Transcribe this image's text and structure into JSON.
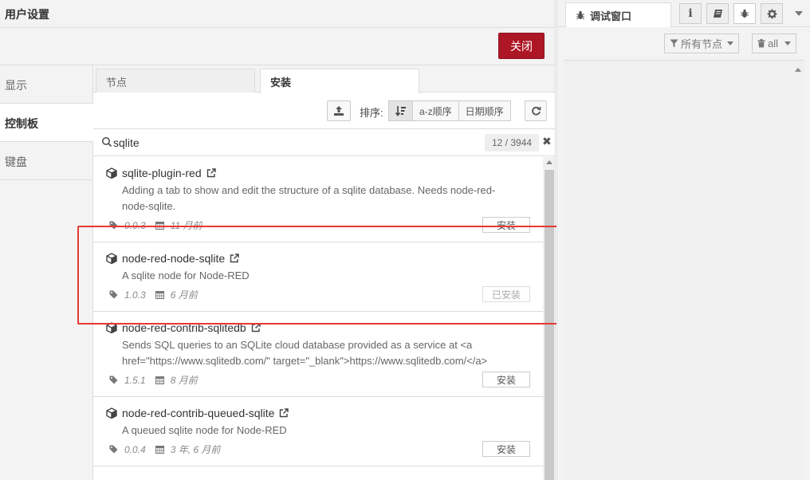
{
  "dialog": {
    "title": "用户设置",
    "close_label": "关闭"
  },
  "side_nav": [
    {
      "label": "显示",
      "active": false
    },
    {
      "label": "控制板",
      "active": true
    },
    {
      "label": "键盘",
      "active": false
    }
  ],
  "tabs": {
    "nodes": "节点",
    "install": "安装"
  },
  "toolbar": {
    "sort_label": "排序:",
    "sort_az": "a-z顺序",
    "sort_date": "日期顺序"
  },
  "search": {
    "value": "sqlite",
    "count": "12 / 3944"
  },
  "packages": [
    {
      "name": "sqlite-plugin-red",
      "description": "Adding a tab to show and edit the structure of a sqlite database. Needs node-red-node-sqlite.",
      "version": "0.0.3",
      "updated": "11 月前",
      "button": "安装",
      "installed": false
    },
    {
      "name": "node-red-node-sqlite",
      "description": "A sqlite node for Node-RED",
      "version": "1.0.3",
      "updated": "6 月前",
      "button": "已安装",
      "installed": true
    },
    {
      "name": "node-red-contrib-sqlitedb",
      "description": "Sends SQL queries to an SQLite cloud database provided as a service at <a href=\"https://www.sqlitedb.com/\" target=\"_blank\">https://www.sqlitedb.com/</a>",
      "version": "1.5.1",
      "updated": "8 月前",
      "button": "安装",
      "installed": false
    },
    {
      "name": "node-red-contrib-queued-sqlite",
      "description": "A queued sqlite node for Node-RED",
      "version": "0.0.4",
      "updated": "3 年, 6 月前",
      "button": "安装",
      "installed": false
    }
  ],
  "debug": {
    "tab_label": "调试窗口",
    "filter_nodes": "所有节点",
    "filter_all": "all"
  },
  "colors": {
    "accent_red": "#ad1625",
    "highlight_red": "#e53935"
  }
}
